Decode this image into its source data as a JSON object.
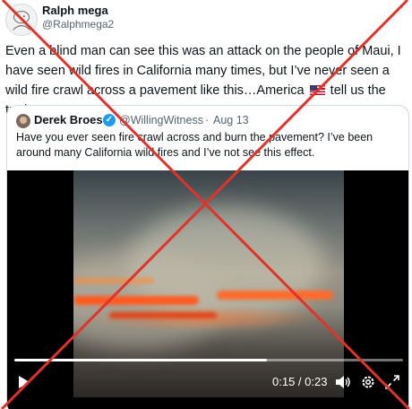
{
  "post": {
    "author_name": "Ralph mega",
    "author_handle": "@Ralphmega2",
    "text_before_flag": "Even a blind man can see this was an attack on the people of Maui, I have seen wild fires in California many times, but I’ve never seen a wild fire crawl across a pavement like this…America",
    "text_after_flag": " tell us the truth",
    "flag_icon": "us-flag-icon"
  },
  "quote": {
    "author_name": "Derek Broes",
    "author_handle": "@WillingWitness",
    "separator": "·",
    "date": "Aug 13",
    "text": "Have you ever seen fire crawl across and burn the pavement? I’ve been around many California wild fires and I’ve not see this effect.",
    "verified_icon": "verified-badge-icon"
  },
  "video": {
    "time": "0:15 / 0:23",
    "progress": 0.65,
    "icons": [
      "play-icon",
      "volume-icon",
      "settings-gear-icon",
      "fullscreen-icon"
    ]
  },
  "overlay": {
    "mark": "red-x-cross",
    "color": "#e0332a"
  }
}
